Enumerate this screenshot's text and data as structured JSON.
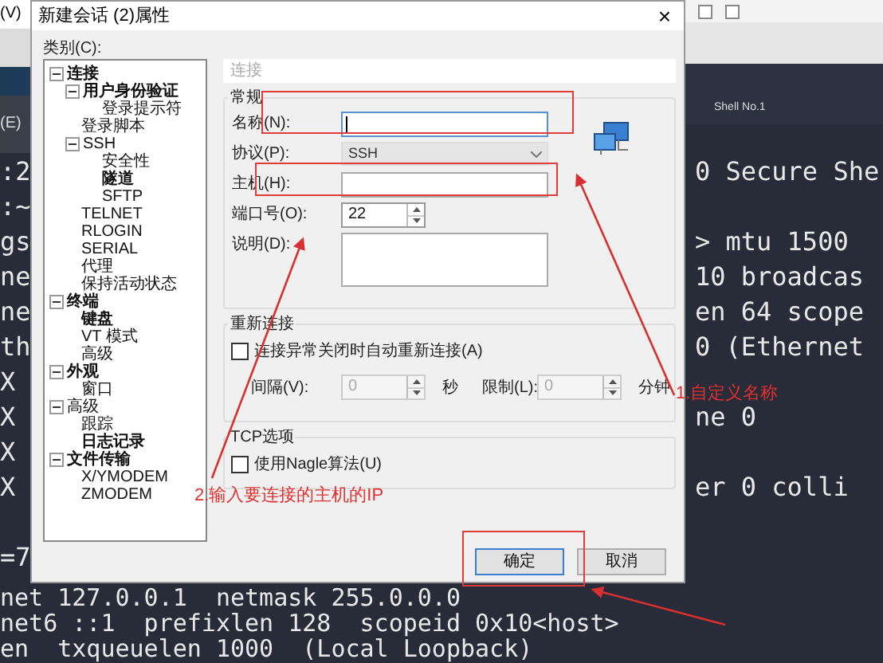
{
  "app": {
    "menu_fragments": [
      "(V)",
      "(E)"
    ],
    "tab_label": "Shell No.1"
  },
  "terminal": {
    "rows": [
      {
        "left": ":2",
        "right": "0 Secure She"
      },
      {
        "left": ":~"
      },
      {
        "left": "gs",
        "right": "> mtu 1500"
      },
      {
        "left": "ne",
        "right": "10 broadcas"
      },
      {
        "left": "ne",
        "right": "en 64 scope"
      },
      {
        "left": "th",
        "right": "0 (Ethernet"
      },
      {
        "left": "X"
      },
      {
        "left": "X",
        "right": "ne 0"
      },
      {
        "left": "X"
      },
      {
        "left": "X",
        "right": "er 0 colli"
      },
      {},
      {
        "left": "=7"
      }
    ],
    "bottom_lines": [
      "net 127.0.0.1  netmask 255.0.0.0",
      "net6 ::1  prefixlen 128  scopeid 0x10<host>",
      "en  txqueuelen 1000  (Local Loopback)"
    ]
  },
  "dialog": {
    "title": "新建会话 (2)属性",
    "close": "×",
    "category_label": "类别(C):",
    "tree": [
      {
        "label": "连接",
        "bold": true,
        "expanded": true,
        "children": [
          {
            "label": "用户身份验证",
            "bold": true,
            "expanded": true,
            "children": [
              {
                "label": "登录提示符",
                "bold": false
              }
            ]
          },
          {
            "label": "登录脚本",
            "bold": false
          },
          {
            "label": "SSH",
            "bold": false,
            "expanded": true,
            "children": [
              {
                "label": "安全性",
                "bold": false
              },
              {
                "label": "隧道",
                "bold": true
              },
              {
                "label": "SFTP",
                "bold": false
              }
            ]
          },
          {
            "label": "TELNET",
            "bold": false
          },
          {
            "label": "RLOGIN",
            "bold": false
          },
          {
            "label": "SERIAL",
            "bold": false
          },
          {
            "label": "代理",
            "bold": false
          },
          {
            "label": "保持活动状态",
            "bold": false
          }
        ]
      },
      {
        "label": "终端",
        "bold": true,
        "expanded": true,
        "children": [
          {
            "label": "键盘",
            "bold": true
          },
          {
            "label": "VT 模式",
            "bold": false
          },
          {
            "label": "高级",
            "bold": false
          }
        ]
      },
      {
        "label": "外观",
        "bold": true,
        "expanded": true,
        "children": [
          {
            "label": "窗口",
            "bold": false
          }
        ]
      },
      {
        "label": "高级",
        "bold": false,
        "expanded": true,
        "children": [
          {
            "label": "跟踪",
            "bold": false
          },
          {
            "label": "日志记录",
            "bold": true
          }
        ]
      },
      {
        "label": "文件传输",
        "bold": true,
        "expanded": true,
        "children": [
          {
            "label": "X/YMODEM",
            "bold": false
          },
          {
            "label": "ZMODEM",
            "bold": false
          }
        ]
      }
    ],
    "page_title": "连接",
    "general": {
      "title": "常规",
      "fields": [
        {
          "kind": "text",
          "label": "名称(N):",
          "focused": true
        },
        {
          "kind": "select",
          "label": "协议(P):",
          "value": "SSH"
        },
        {
          "kind": "text",
          "label": "主机(H):",
          "focused": false
        },
        {
          "kind": "spin",
          "label": "端口号(O):",
          "value": "22"
        },
        {
          "kind": "textarea",
          "label": "说明(D):"
        }
      ]
    },
    "reconnect": {
      "title": "重新连接",
      "checkbox": {
        "label": "连接异常关闭时自动重新连接(A)",
        "checked": false
      },
      "spins": [
        {
          "label": "间隔(V):",
          "value": "0",
          "unit": "秒"
        },
        {
          "label": "限制(L):",
          "value": "0",
          "unit": "分钟"
        }
      ]
    },
    "tcp": {
      "title": "TCP选项",
      "checkbox": {
        "label": "使用Nagle算法(U)",
        "checked": false
      }
    },
    "buttons": [
      {
        "label": "确定",
        "default": true
      },
      {
        "label": "取消",
        "default": false
      }
    ]
  },
  "annotations": [
    {
      "text": "1.自定义名称"
    },
    {
      "text": "2.输入要连接的主机的IP"
    }
  ]
}
